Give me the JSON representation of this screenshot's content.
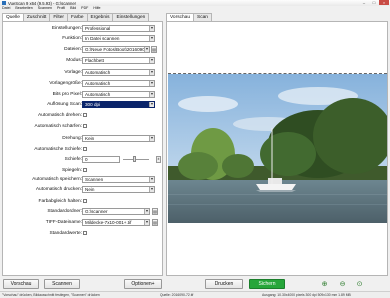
{
  "window": {
    "title": "VueScan 9 x64 (9.5.93) - G:\\scanner",
    "controls": [
      "–",
      "□",
      "×"
    ]
  },
  "menu": [
    "Datei",
    "Bearbeiten",
    "Scannen",
    "Profil",
    "Bild",
    "PDF",
    "Hilfe"
  ],
  "tabs_left": [
    "Quelle",
    "Zuschnitt",
    "Filter",
    "Farbe",
    "Ergebnis",
    "Einstellungen"
  ],
  "tabs_right": [
    "Vorschau",
    "Scan"
  ],
  "fields": {
    "einstellungen": {
      "label": "Einstellungen:",
      "value": "Professional"
    },
    "funktion": {
      "label": "Funktion:",
      "value": "In Datei scannen"
    },
    "dateien": {
      "label": "Dateien:",
      "value": "G:\\Neue Fotos\\Boot\\2016090"
    },
    "modus": {
      "label": "Modus:",
      "value": "Flachbett"
    },
    "vorlage": {
      "label": "Vorlage:",
      "value": "Automatisch"
    },
    "vorlagengroesse": {
      "label": "Vorlagengröße:",
      "value": "Automatisch"
    },
    "bits": {
      "label": "Bits pro Pixel:",
      "value": "Automatisch"
    },
    "aufloesung": {
      "label": "Auflösung Scan:",
      "value": "300 dpi"
    },
    "auto_drehen": {
      "label": "Automatisch drehen:"
    },
    "auto_schaerfen": {
      "label": "Automatisch schärfen:"
    },
    "drehung": {
      "label": "Drehung:",
      "value": "Kein"
    },
    "auto_schiefe": {
      "label": "Automatische Schiefe:"
    },
    "schiefe": {
      "label": "Schiefe:",
      "value": "0"
    },
    "spiegeln": {
      "label": "Spiegeln:"
    },
    "auto_speichern": {
      "label": "Automatisch speichern:",
      "value": "Scannen"
    },
    "auto_drucken": {
      "label": "Automatisch drucken:",
      "value": "Nein"
    },
    "farbabgleich": {
      "label": "Farbabgleich halten:"
    },
    "standardordner": {
      "label": "Standardordner:",
      "value": "G:\\scanner"
    },
    "tiff": {
      "label": "TIFF-Dateiname:",
      "value": "Mildecke-7x10-001+.tif"
    },
    "standardwerte": {
      "label": "Standardwerte:"
    }
  },
  "buttons": {
    "vorschau": "Vorschau",
    "scannen": "Scannen",
    "optionen": "Optionen+",
    "drucken": "Drucken",
    "sichern": "Sichern"
  },
  "status": {
    "left": "\"Vorschau\" drücken, Bildausschnitt festlegen, \"Scannen\" drücken",
    "mid": "Quelle: 2016090-72.tif",
    "right": "Ausgang: 10.30x4000 pixels 300 dpi 509x130 mm 1.89 MB"
  },
  "colors": {
    "highlight": "#0a246a",
    "green": "#26a63a",
    "close": "#c94b45"
  }
}
